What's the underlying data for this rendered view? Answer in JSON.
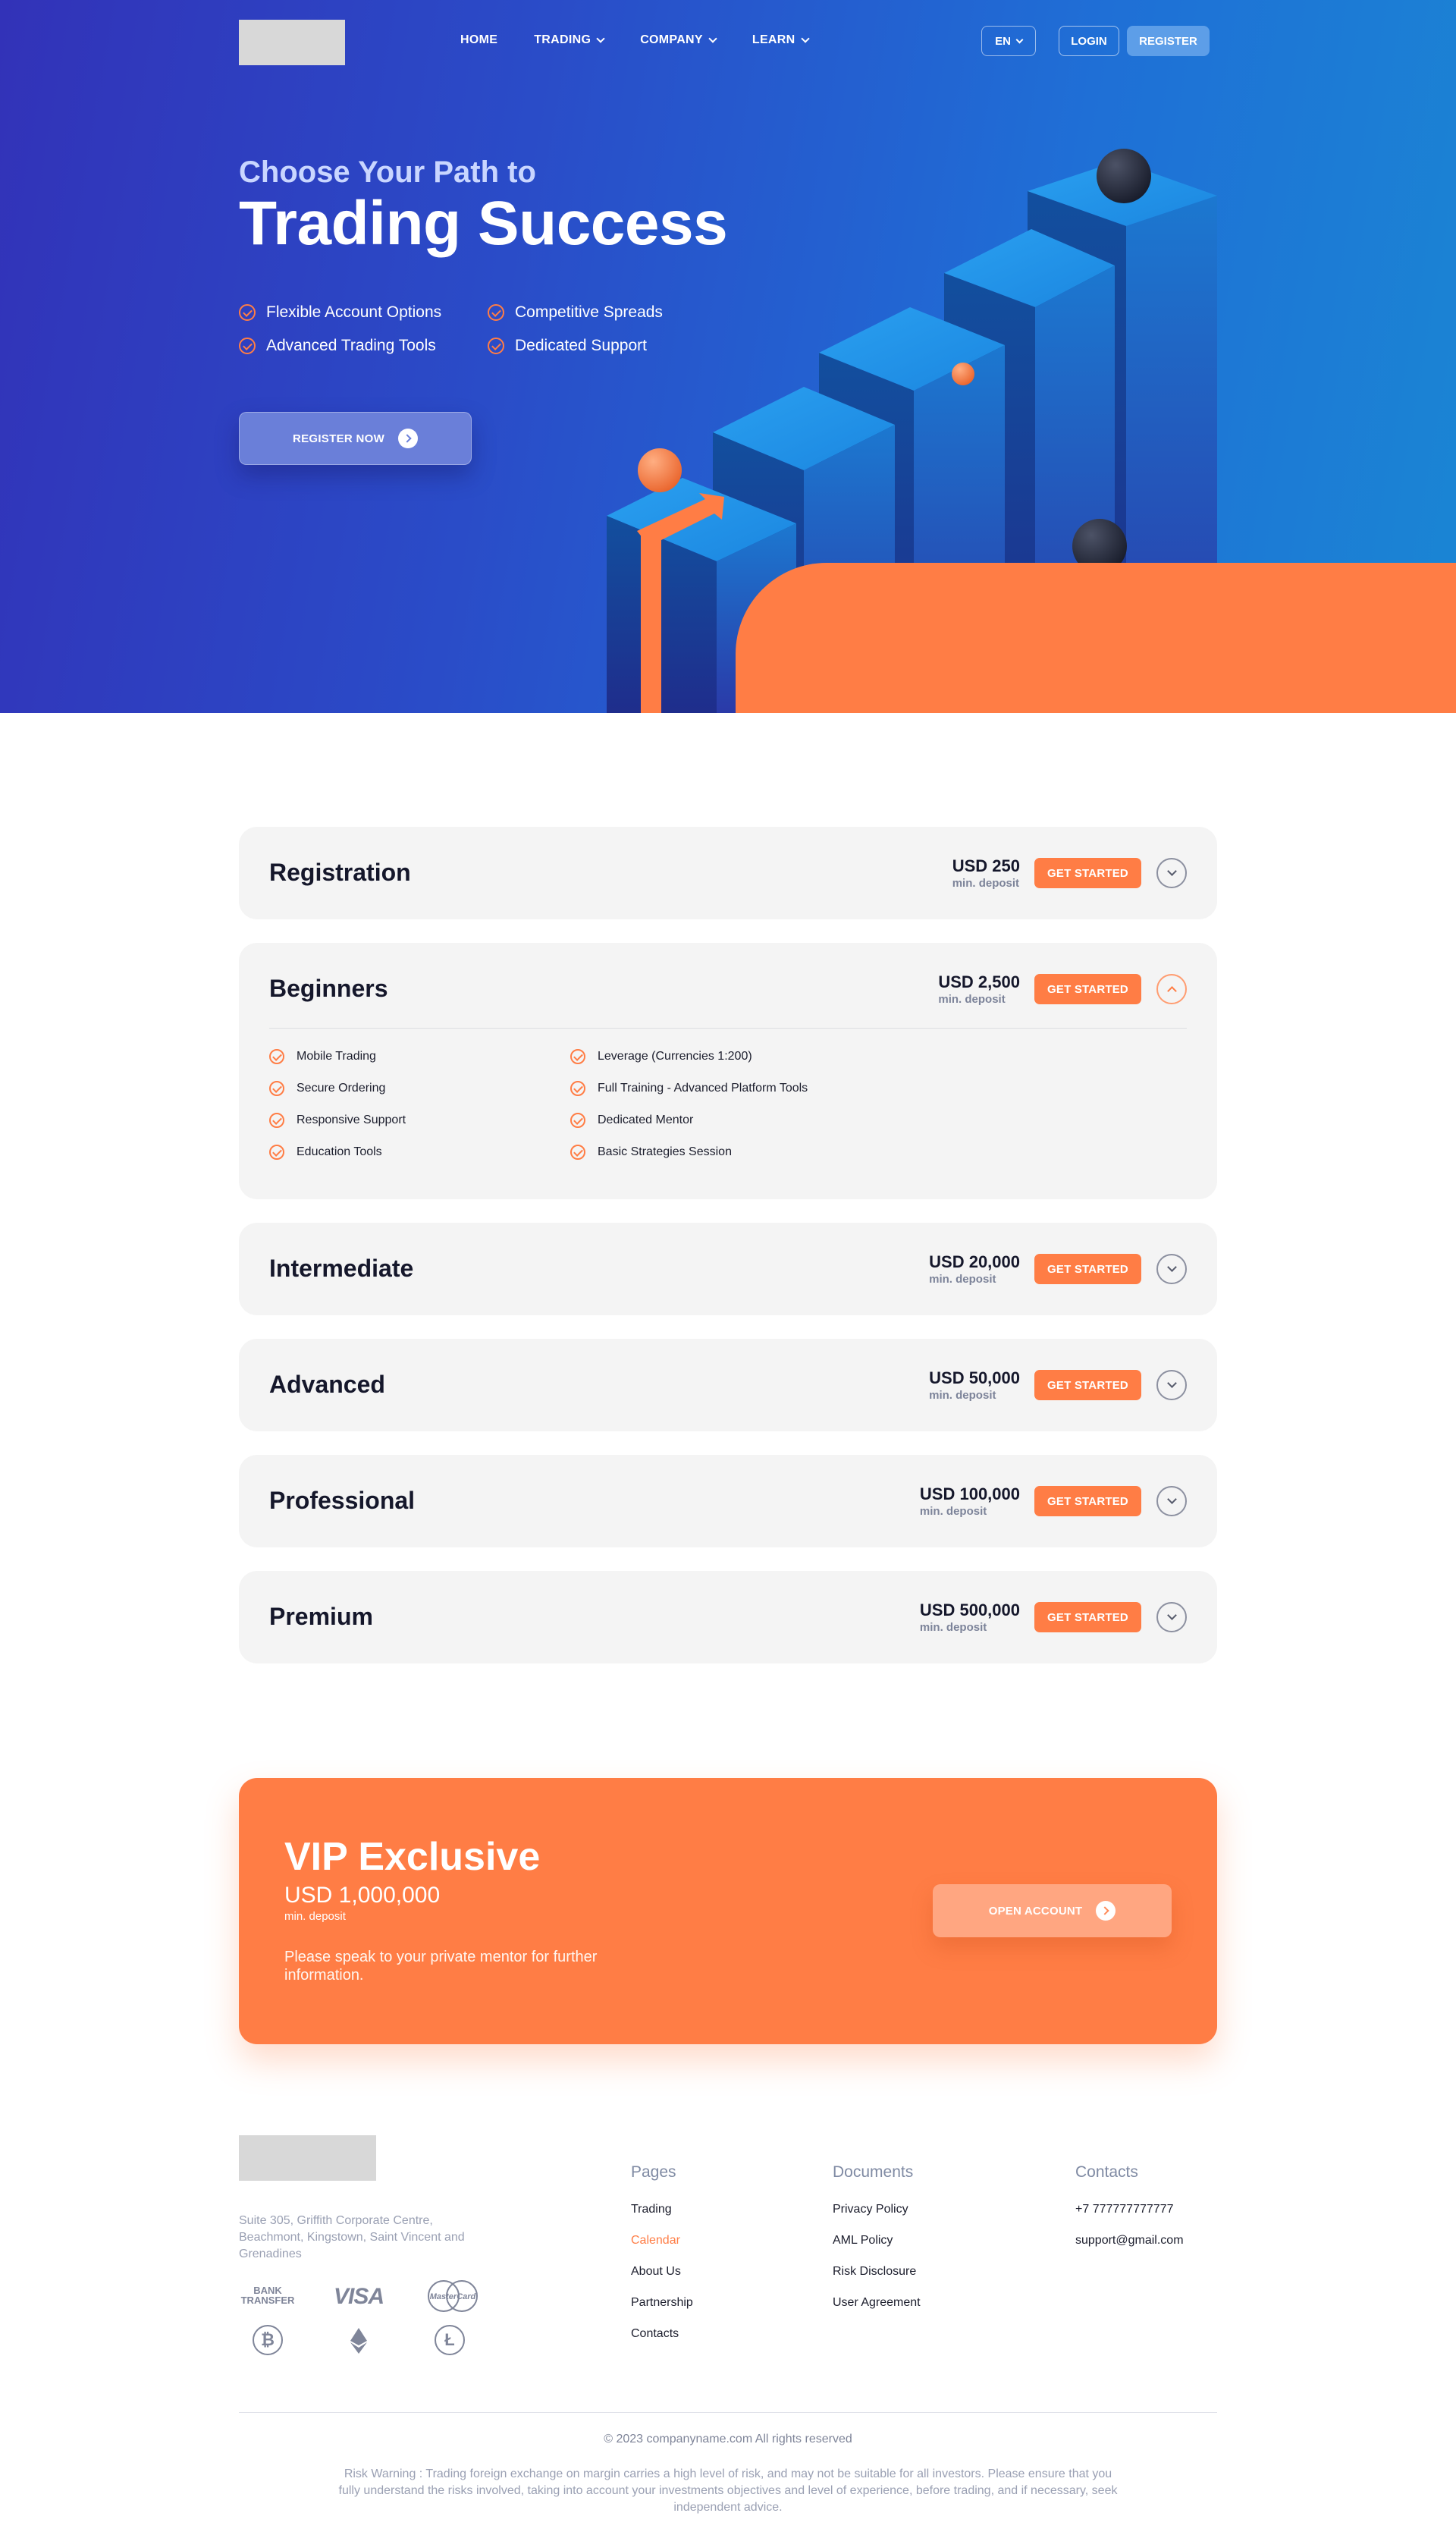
{
  "nav": {
    "home": "HOME",
    "trading": "TRADING",
    "company": "COMPANY",
    "learn": "LEARN",
    "lang": "EN",
    "login": "LOGIN",
    "register": "REGISTER"
  },
  "hero": {
    "subtitle": "Choose Your Path to",
    "title": "Trading Success",
    "features": [
      "Flexible Account Options",
      "Competitive Spreads",
      "Advanced Trading Tools",
      "Dedicated Support"
    ],
    "cta": "REGISTER NOW"
  },
  "plans": [
    {
      "name": "Registration",
      "amount": "USD 250",
      "min": "min. deposit",
      "button": "GET STARTED",
      "expanded": false
    },
    {
      "name": "Beginners",
      "amount": "USD 2,500",
      "min": "min. deposit",
      "button": "GET STARTED",
      "expanded": true,
      "features": [
        "Mobile Trading",
        "Leverage (Currencies 1:200)",
        "Secure Ordering",
        "Full Training - Advanced Platform Tools",
        "Responsive Support",
        "Dedicated Mentor",
        "Education Tools",
        "Basic Strategies Session"
      ]
    },
    {
      "name": "Intermediate",
      "amount": "USD 20,000",
      "min": "min. deposit",
      "button": "GET STARTED",
      "expanded": false
    },
    {
      "name": "Advanced",
      "amount": "USD 50,000",
      "min": "min. deposit",
      "button": "GET STARTED",
      "expanded": false
    },
    {
      "name": "Professional",
      "amount": "USD 100,000",
      "min": "min. deposit",
      "button": "GET STARTED",
      "expanded": false
    },
    {
      "name": "Premium",
      "amount": "USD 500,000",
      "min": "min. deposit",
      "button": "GET STARTED",
      "expanded": false
    }
  ],
  "vip": {
    "title": "VIP Exclusive",
    "amount": "USD 1,000,000",
    "min": "min. deposit",
    "note": "Please speak to your private mentor for further information.",
    "button": "OPEN ACCOUNT"
  },
  "footer": {
    "address": "Suite 305, Griffith Corporate Centre, Beachmont, Kingstown, Saint Vincent and Grenadines",
    "payments": {
      "bank_line1": "BANK",
      "bank_line2": "TRANSFER",
      "visa": "VISA",
      "mastercard": "MasterCard",
      "coin_icons": [
        "bitcoin-icon",
        "ethereum-icon",
        "litecoin-icon"
      ]
    },
    "pages_title": "Pages",
    "pages": [
      "Trading",
      "Calendar",
      "About Us",
      "Partnership",
      "Contacts"
    ],
    "documents_title": "Documents",
    "documents": [
      "Privacy Policy",
      "AML Policy",
      "Risk Disclosure",
      "User Agreement"
    ],
    "contacts_title": "Contacts",
    "contacts": [
      "+7 777777777777",
      "support@gmail.com"
    ],
    "copyright": "© 2023 companyname.com All rights reserved",
    "risk_warning": "Risk Warning : Trading foreign exchange on margin carries a high level of risk, and may not be suitable for all investors. Please ensure that you fully understand the risks involved, taking into account your investments objectives and level of experience, before trading, and if necessary, seek independent advice."
  },
  "colors": {
    "accent": "#ff7d45",
    "hero_start": "#3232b8",
    "hero_end": "#1a86d4",
    "card_bg": "#f4f4f4"
  }
}
